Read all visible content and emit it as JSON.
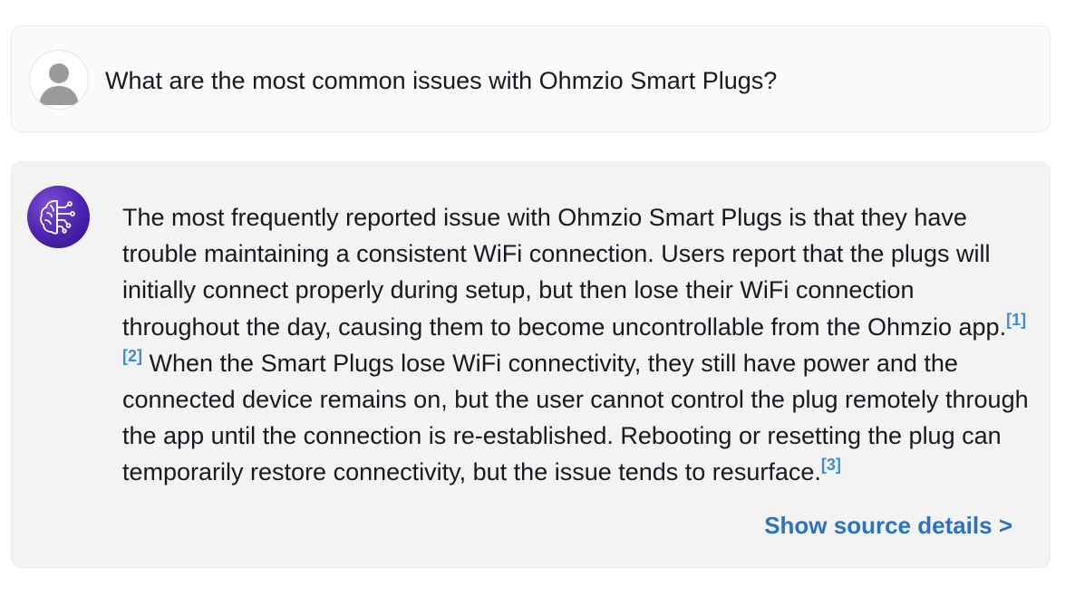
{
  "user_message": {
    "text": "What are the most common issues with Ohmzio Smart Plugs?",
    "avatar_icon": "user-silhouette-icon"
  },
  "assistant_message": {
    "avatar_icon": "ai-brain-circuit-icon",
    "segments": [
      {
        "type": "text",
        "value": "The most frequently reported issue with Ohmzio Smart Plugs is that they have trouble maintaining a consistent WiFi connection. Users report that the plugs will initially connect properly during setup, but then lose their WiFi connection throughout the day, causing them to become uncontrollable from the Ohmzio app."
      },
      {
        "type": "citation",
        "value": "[1]"
      },
      {
        "type": "citation",
        "value": "[2]"
      },
      {
        "type": "text",
        "value": " When the Smart Plugs lose WiFi connectivity, they still have power and the connected device remains on, but the user cannot control the plug remotely through the app until the connection is re-established. Rebooting or resetting the plug can temporarily restore connectivity, but the issue tends to resurface."
      },
      {
        "type": "citation",
        "value": "[3]"
      }
    ],
    "source_link_label": "Show source details >"
  },
  "colors": {
    "citation": "#3e8ad6",
    "link": "#2a72c4",
    "ai_avatar": "#4c22b0"
  }
}
